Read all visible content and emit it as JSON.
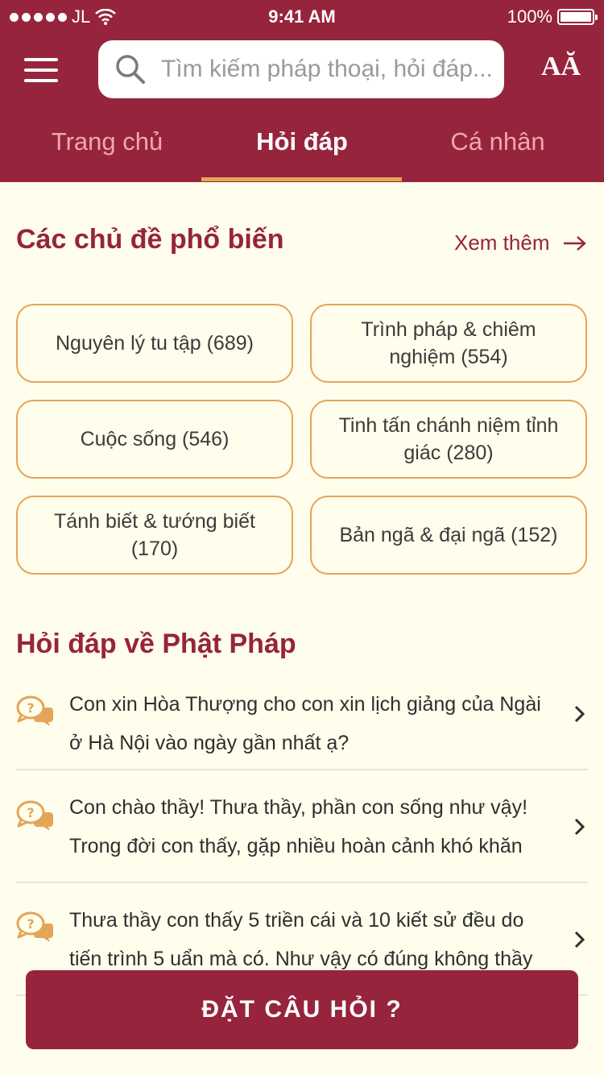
{
  "status_bar": {
    "carrier": "JL",
    "time": "9:41 AM",
    "battery": "100%"
  },
  "header": {
    "search_placeholder": "Tìm kiếm pháp thoại, hỏi đáp...",
    "font_size_label": "AĂ"
  },
  "tabs": [
    {
      "label": "Trang chủ",
      "active": false
    },
    {
      "label": "Hỏi đáp",
      "active": true
    },
    {
      "label": "Cá nhân",
      "active": false
    }
  ],
  "topics_section": {
    "title": "Các chủ đề phổ biến",
    "see_more": "Xem thêm",
    "topics": [
      {
        "label": "Nguyên lý tu tập (689)"
      },
      {
        "label": "Trình pháp & chiêm nghiệm (554)"
      },
      {
        "label": "Cuộc sống (546)"
      },
      {
        "label": "Tinh tấn chánh niệm tỉnh giác (280)"
      },
      {
        "label": "Tánh biết & tướng biết (170)"
      },
      {
        "label": "Bản ngã & đại ngã (152)"
      }
    ]
  },
  "qa_section": {
    "title": "Hỏi đáp về Phật Pháp",
    "items": [
      {
        "text": "Con xin Hòa Thượng cho con xin lịch giảng của Ngài ở Hà Nội vào ngày gần nhất ạ?"
      },
      {
        "text": "Con chào thầy! Thưa thầy, phần con sống như vậy! Trong đời con thấy, gặp nhiều hoàn cảnh khó khăn"
      },
      {
        "text": "Thưa thầy con thấy 5 triền cái và 10 kiết sử đều do tiến trình 5 uẩn mà có. Như vậy có đúng không thầy"
      }
    ]
  },
  "ask_button": {
    "label": "ĐẶT CÂU HỎI ?"
  },
  "colors": {
    "primary": "#96243d",
    "accent": "#e3a55a",
    "background": "#fffdeb",
    "tab_inactive": "#f0a8a6"
  }
}
